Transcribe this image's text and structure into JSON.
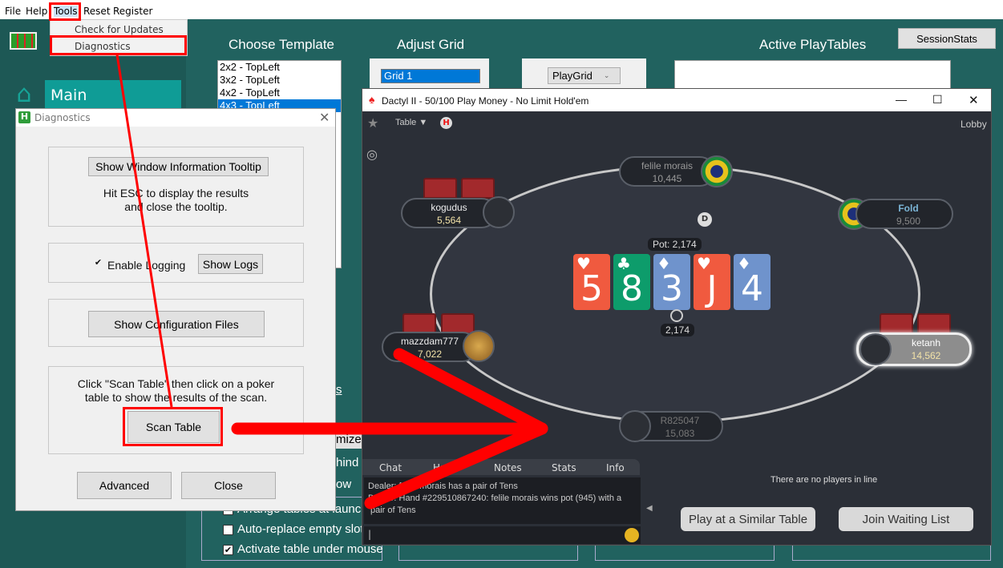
{
  "menu": {
    "items": [
      "File",
      "Help",
      "Tools",
      "Reset",
      "Register"
    ],
    "tools_menu": [
      "Check for Updates",
      "Diagnostics"
    ]
  },
  "sidebar": {
    "main_label": "Main",
    "icons": [
      "home-icon",
      "gear-icon",
      "phone-icon",
      "link-icon",
      "document-icon",
      "globe-icon",
      "film-icon",
      "stack-icon",
      "cloud-icon",
      "battery-icon"
    ]
  },
  "main": {
    "choose_template": "Choose Template",
    "templates": [
      "2x2 - TopLeft",
      "3x2 - TopLeft",
      "4x2 - TopLeft",
      "4x3 - TopLeft"
    ],
    "adjust_grid": "Adjust Grid",
    "grid_value": "Grid 1",
    "playgrid_select": "PlayGrid",
    "active_playtables": "Active PlayTables",
    "sessionstats": "SessionStats",
    "partial_labels": [
      "s",
      "n",
      "mize",
      "hind",
      "ow"
    ],
    "checkboxes": [
      {
        "label": "Arrange tables at launch",
        "checked": false
      },
      {
        "label": "Auto-replace empty slots",
        "checked": false
      },
      {
        "label": "Activate table under mouse",
        "checked": true
      }
    ]
  },
  "diagnostics": {
    "title": "Diagnostics",
    "tooltip_button": "Show Window Information Tooltip",
    "tooltip_help": [
      "Hit ESC to display the results",
      "and close the tooltip."
    ],
    "enable_logging": "Enable Logging",
    "logging_checked": true,
    "show_logs": "Show Logs",
    "show_config": "Show Configuration Files",
    "scan_help": [
      "Click \"Scan Table\" then click on a poker",
      "table to show the results of the scan."
    ],
    "scan_table": "Scan Table",
    "advanced": "Advanced",
    "close": "Close"
  },
  "poker": {
    "title": "Dactyl II - 50/100 Play Money - No Limit Hold'em",
    "table_menu": "Table",
    "lobby": "Lobby",
    "dealer": "D",
    "pot_label": "Pot: 2,174",
    "pot_chips": "2,174",
    "seats": [
      {
        "name": "felile morais",
        "stack": "10,445"
      },
      {
        "name": "kogudus",
        "stack": "5,564"
      },
      {
        "name": "Fold",
        "stack": "9,500"
      },
      {
        "name": "mazzdam777",
        "stack": "7,022"
      },
      {
        "name": "ketanh",
        "stack": "14,562"
      },
      {
        "name": "R825047",
        "stack": "15,083"
      }
    ],
    "board": [
      {
        "rank": "5",
        "suit": "♥",
        "color": "#f05a3f"
      },
      {
        "rank": "8",
        "suit": "♣",
        "color": "#0d9c6b"
      },
      {
        "rank": "3",
        "suit": "♦",
        "color": "#6f93cc"
      },
      {
        "rank": "J",
        "suit": "♥",
        "color": "#f05a3f"
      },
      {
        "rank": "4",
        "suit": "♦",
        "color": "#6f93cc"
      }
    ],
    "tabs": [
      "Chat",
      "Hand",
      "Notes",
      "Stats",
      "Info"
    ],
    "chat": [
      "Dealer: felile morais has a pair of Tens",
      "Dealer: Hand #229510867240: felile morais wins pot (945) with a",
      "pair of Tens"
    ],
    "waiting": "There are no players in line",
    "similar": "Play at a Similar Table",
    "join": "Join Waiting List"
  },
  "colors": {
    "teal_bg": "#21625f",
    "accent": "#0f9c96",
    "annotation": "#ff0000",
    "felt": "#2b2f37"
  }
}
